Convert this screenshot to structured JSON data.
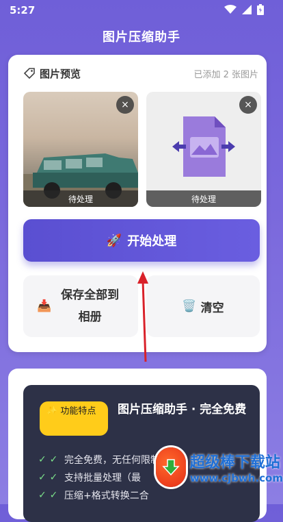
{
  "status": {
    "time": "5:27"
  },
  "appbar": {
    "title": "图片压缩助手"
  },
  "preview": {
    "title": "图片预览",
    "count": "已添加 2 张图片",
    "thumbs": [
      {
        "label": "待处理"
      },
      {
        "label": "待处理"
      }
    ],
    "close_glyph": "×"
  },
  "actions": {
    "process_label": "开始处理",
    "save_label": "保存全部到相册",
    "clear_label": "清空"
  },
  "promo": {
    "badge": "功能特点",
    "title": "图片压缩助手 · 完全免费",
    "items": [
      "完全免费，无任何限制",
      "支持批量处理（最",
      "压缩+格式转换二合"
    ]
  },
  "watermark": {
    "name": "超级棒下载站",
    "url": "www.cjbwh.com"
  },
  "colors": {
    "primary": "#6a5ee0",
    "badge": "#ffcc1a",
    "panel": "#2d3147",
    "annotation_arrow": "#d9212a"
  }
}
